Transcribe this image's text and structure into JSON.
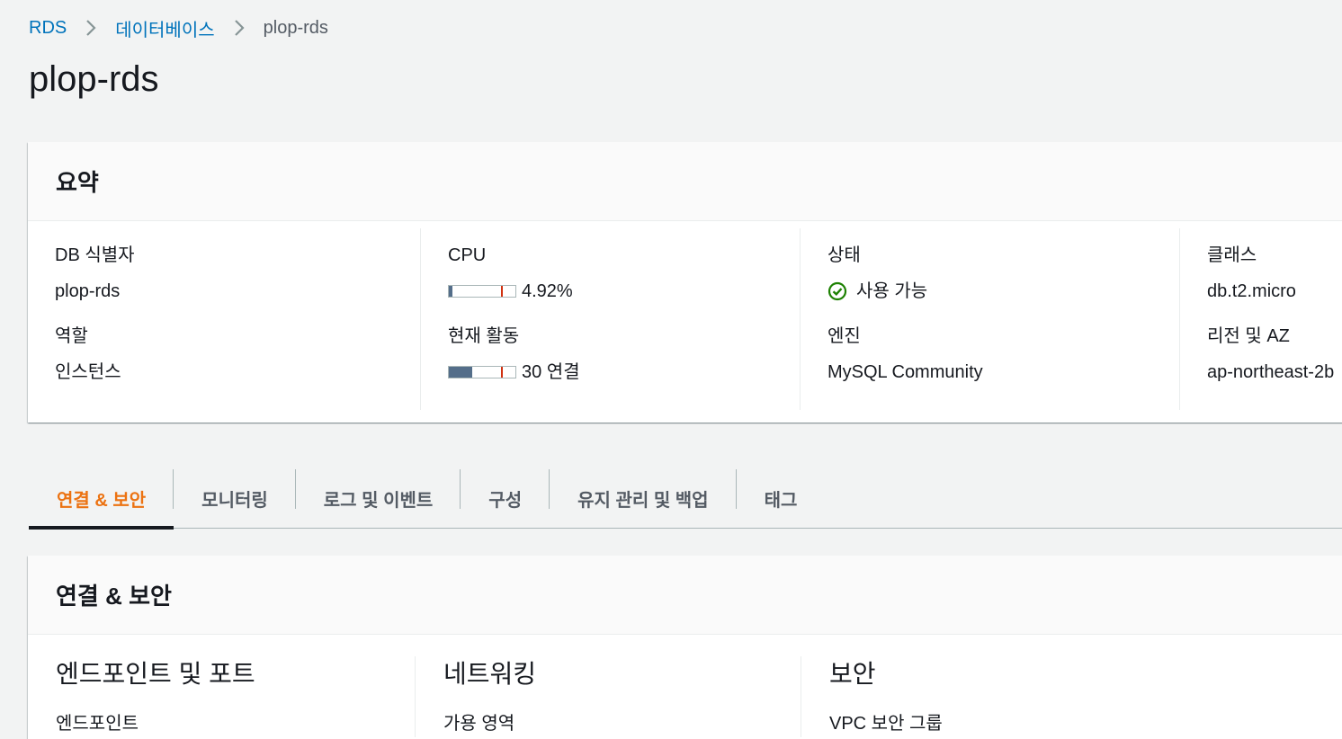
{
  "breadcrumb": {
    "items": [
      "RDS",
      "데이터베이스"
    ],
    "current": "plop-rds"
  },
  "page_title": "plop-rds",
  "summary": {
    "title": "요약",
    "db_identifier_label": "DB 식별자",
    "db_identifier_value": "plop-rds",
    "role_label": "역할",
    "role_value": "인스턴스",
    "cpu_label": "CPU",
    "cpu_value": "4.92%",
    "cpu_fraction": 0.0492,
    "activity_label": "현재 활동",
    "activity_value": "30 연결",
    "activity_fraction": 0.35,
    "status_label": "상태",
    "status_value": "사용 가능",
    "engine_label": "엔진",
    "engine_value": "MySQL Community",
    "class_label": "클래스",
    "class_value": "db.t2.micro",
    "region_label": "리전 및 AZ",
    "region_value": "ap-northeast-2b"
  },
  "tabs": [
    {
      "label": "연결 & 보안",
      "active": true
    },
    {
      "label": "모니터링",
      "active": false
    },
    {
      "label": "로그 및 이벤트",
      "active": false
    },
    {
      "label": "구성",
      "active": false
    },
    {
      "label": "유지 관리 및 백업",
      "active": false
    },
    {
      "label": "태그",
      "active": false
    }
  ],
  "connectivity": {
    "title": "연결 & 보안",
    "sections": [
      {
        "heading": "엔드포인트 및 포트",
        "first_label": "엔드포인트"
      },
      {
        "heading": "네트워킹",
        "first_label": "가용 영역"
      },
      {
        "heading": "보안",
        "first_label": "VPC 보안 그룹"
      }
    ]
  },
  "colors": {
    "link": "#0073bb",
    "status_ok": "#1d8102",
    "active_tab": "#ec7211",
    "meter_fill": "#546e8a",
    "meter_tick": "#d13212"
  },
  "icons": {
    "breadcrumb_separator": "chevron-right-icon",
    "status": "check-circle-icon"
  }
}
